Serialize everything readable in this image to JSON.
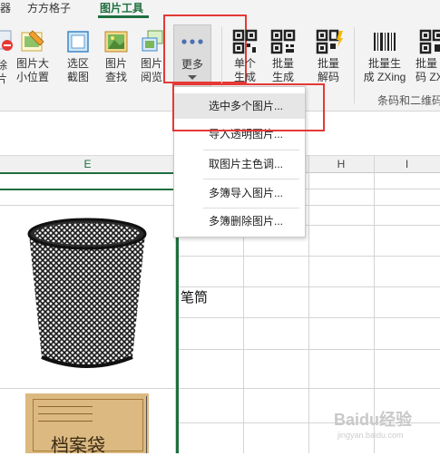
{
  "tabs": [
    "器",
    "方方格子",
    "图片工具"
  ],
  "ribbon": {
    "partial_label_top": "除",
    "partial_label_bottom": "片",
    "pic_size_top": "图片大",
    "pic_size_bottom": "小位置",
    "area_shot_top": "选区",
    "area_shot_bottom": "截图",
    "pic_find_top": "图片",
    "pic_find_bottom": "查找",
    "pic_view_top": "图片",
    "pic_view_bottom": "阅览",
    "more_label": "更多",
    "single_gen_top": "单个",
    "single_gen_bottom": "生成",
    "batch_gen_top": "批量",
    "batch_gen_bottom": "生成",
    "batch_decode_top": "批量",
    "batch_decode_bottom": "解码",
    "batch_zxing_top": "批量生",
    "batch_zxing_bottom": "成 ZXing",
    "batch_zx2_top": "批量",
    "batch_zx2_bottom": "码 ZX",
    "group_label": "条码和二维码"
  },
  "menu": {
    "items": [
      "选中多个图片...",
      "导入透明图片...",
      "取图片主色调...",
      "多簿导入图片...",
      "多簿删除图片..."
    ]
  },
  "grid": {
    "columns": [
      "E",
      "H",
      "I"
    ],
    "cell_text": "笔筒"
  },
  "images": {
    "file_bag_text": "档案袋"
  },
  "watermark": {
    "text": "Baidu经验",
    "sub": "jingyan.baidu.com"
  },
  "colors": {
    "accent": "#1e6f3e",
    "highlight": "#e53935"
  }
}
